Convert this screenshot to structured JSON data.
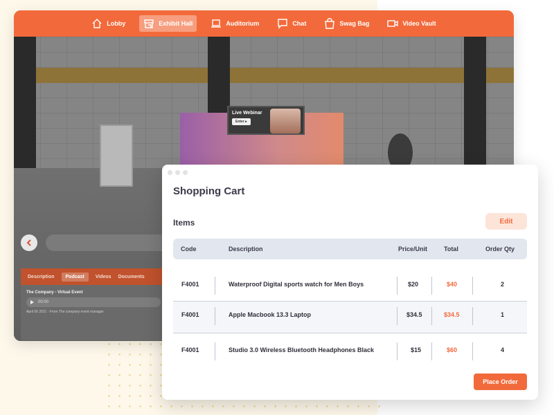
{
  "nav": {
    "items": [
      {
        "label": "Lobby",
        "icon": "home-icon",
        "active": false
      },
      {
        "label": "Exhibit Hall",
        "icon": "booth-icon",
        "active": true
      },
      {
        "label": "Auditorium",
        "icon": "laptop-icon",
        "active": false
      },
      {
        "label": "Chat",
        "icon": "chat-icon",
        "active": false
      },
      {
        "label": "Swag Bag",
        "icon": "bag-icon",
        "active": false
      },
      {
        "label": "Video Vault",
        "icon": "video-icon",
        "active": false
      }
    ]
  },
  "booth": {
    "screen_title": "Live Webinar",
    "screen_button": "Enter ▸"
  },
  "media": {
    "tabs": [
      "Description",
      "Podcast",
      "Videos",
      "Documents"
    ],
    "active_tab": "Podcast",
    "title": "The Company - Virtual Event",
    "player_time": "00:00",
    "meta": "April 06 2021 - From The company event manager"
  },
  "cart": {
    "title": "Shopping Cart",
    "items_label": "Items",
    "edit_label": "Edit",
    "columns": {
      "code": "Code",
      "description": "Description",
      "price": "Price/Unit",
      "total": "Total",
      "qty": "Order Qty"
    },
    "rows": [
      {
        "code": "F4001",
        "description": "Waterproof Digital sports watch for Men Boys",
        "price": "$20",
        "total": "$40",
        "qty": "2"
      },
      {
        "code": "F4001",
        "description": "Apple Macbook 13.3 Laptop",
        "price": "$34.5",
        "total": "$34.5",
        "qty": "1"
      },
      {
        "code": "F4001",
        "description": "Studio 3.0 Wireless Bluetooth Headphones Black",
        "price": "$15",
        "total": "$60",
        "qty": "4"
      }
    ],
    "place_order_label": "Place Order"
  },
  "colors": {
    "accent": "#f26a3b",
    "header_row": "#e2e6ee",
    "cream": "#fdf8ea"
  }
}
